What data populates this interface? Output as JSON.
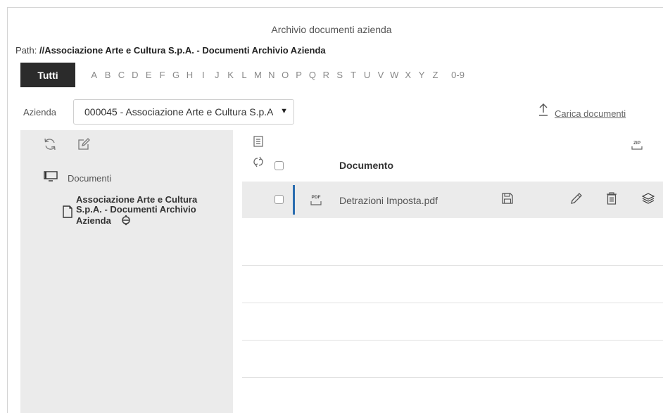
{
  "header": {
    "title": "Archivio documenti azienda",
    "path_label": "Path: ",
    "path_value": "//Associazione Arte e Cultura S.p.A. - Documenti Archivio Azienda"
  },
  "alphabet": {
    "all_label": "Tutti",
    "letters": [
      "A",
      "B",
      "C",
      "D",
      "E",
      "F",
      "G",
      "H",
      "I",
      "J",
      "K",
      "L",
      "M",
      "N",
      "O",
      "P",
      "Q",
      "R",
      "S",
      "T",
      "U",
      "V",
      "W",
      "X",
      "Y",
      "Z"
    ],
    "numeric_label": "0-9"
  },
  "company": {
    "label": "Azienda",
    "selected": "000045 - Associazione Arte e Cultura S.p.A."
  },
  "upload": {
    "label": "Carica documenti",
    "icon": "upload-arrow-icon"
  },
  "tree": {
    "refresh_icon": "refresh-icon",
    "edit_icon": "edit-icon",
    "root_label": "Documenti",
    "child_label": "Associazione Arte e Cultura S.p.A. - Documenti Archivio Azienda"
  },
  "documents": {
    "column_title": "Documento",
    "rows": [
      {
        "name": "Detrazioni Imposta.pdf",
        "type_badge": "PDF"
      }
    ],
    "zip_badge": "ZIP"
  },
  "colors": {
    "accent_bar": "#2a6db0",
    "dark_tab": "#2b2b2b",
    "panel_bg": "#ebebeb"
  }
}
